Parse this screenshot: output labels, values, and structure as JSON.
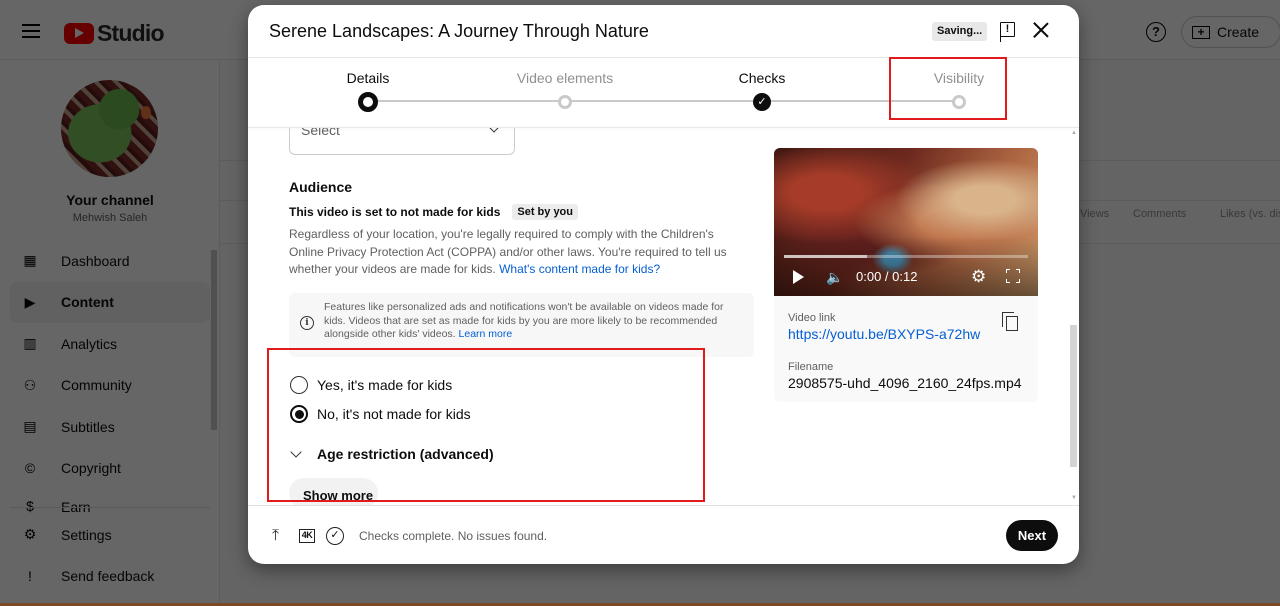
{
  "app": {
    "logo_text": "Studio",
    "create_label": "Create",
    "help_icon": "help-circle-icon"
  },
  "sidebar": {
    "channel_title": "Your channel",
    "channel_name": "Mehwish Saleh",
    "items": [
      {
        "label": "Dashboard",
        "icon": "dashboard-icon",
        "active": false
      },
      {
        "label": "Content",
        "icon": "content-icon",
        "active": true
      },
      {
        "label": "Analytics",
        "icon": "analytics-icon",
        "active": false
      },
      {
        "label": "Community",
        "icon": "community-icon",
        "active": false
      },
      {
        "label": "Subtitles",
        "icon": "subtitles-icon",
        "active": false
      },
      {
        "label": "Copyright",
        "icon": "copyright-icon",
        "active": false
      },
      {
        "label": "Earn",
        "icon": "earn-icon",
        "active": false
      }
    ],
    "bottom_items": [
      {
        "label": "Settings",
        "icon": "gear-icon"
      },
      {
        "label": "Send feedback",
        "icon": "feedback-icon"
      }
    ]
  },
  "background_table": {
    "columns": [
      "Views",
      "Comments",
      "Likes (vs. dislikes)"
    ]
  },
  "modal": {
    "title": "Serene Landscapes: A Journey Through Nature",
    "saving_label": "Saving...",
    "steps": [
      {
        "label": "Details",
        "state": "current"
      },
      {
        "label": "Video elements",
        "state": "pending"
      },
      {
        "label": "Checks",
        "state": "done"
      },
      {
        "label": "Visibility",
        "state": "pending"
      }
    ],
    "select_placeholder": "Select",
    "audience": {
      "title": "Audience",
      "status": "This video is set to not made for kids",
      "chip": "Set by you",
      "description": "Regardless of your location, you're legally required to comply with the Children's Online Privacy Protection Act (COPPA) and/or other laws. You're required to tell us whether your videos are made for kids.",
      "description_link": "What's content made for kids?",
      "info_text": "Features like personalized ads and notifications won't be available on videos made for kids. Videos that are set as made for kids by you are more likely to be recommended alongside other kids' videos.",
      "info_link": "Learn more",
      "options": [
        {
          "label": "Yes, it's made for kids",
          "checked": false
        },
        {
          "label": "No, it's not made for kids",
          "checked": true
        }
      ],
      "age_restriction_label": "Age restriction (advanced)",
      "show_more_label": "Show more"
    },
    "preview": {
      "time": "0:00 / 0:12",
      "buffered_fraction": 0.34,
      "video_link_label": "Video link",
      "video_link": "https://youtu.be/BXYPS-a72hw",
      "filename_label": "Filename",
      "filename": "2908575-uhd_4096_2160_24fps.mp4"
    },
    "footer": {
      "status": "Checks complete. No issues found.",
      "hd_badge": "4K",
      "next_label": "Next"
    }
  },
  "colors": {
    "accent_red": "#ff0000",
    "highlight_border": "#e11b1b",
    "link_blue": "#065fd4"
  }
}
